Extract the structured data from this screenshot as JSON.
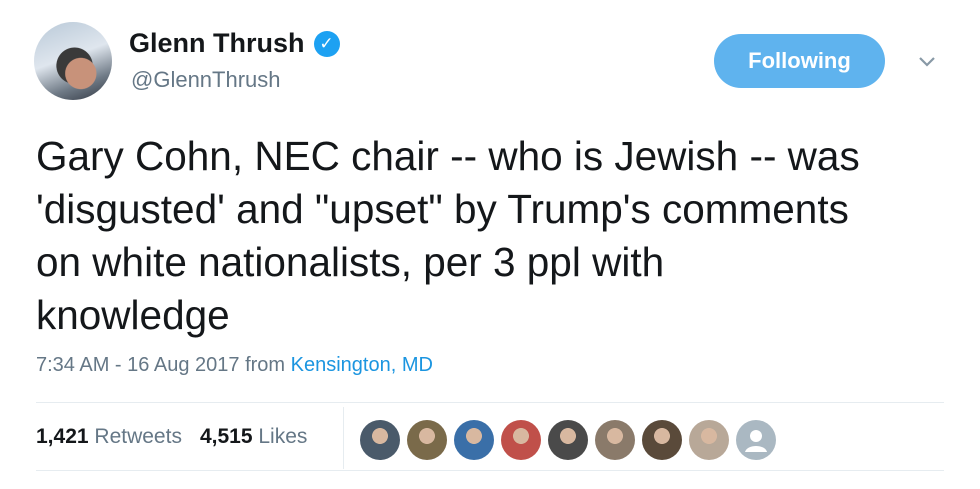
{
  "author": {
    "name": "Glenn Thrush",
    "handle": "@GlennThrush",
    "verified_icon": "verified-check-icon"
  },
  "follow_button": {
    "label": "Following"
  },
  "caret_icon": "chevron-down-icon",
  "tweet": {
    "text": "Gary Cohn, NEC chair -- who is Jewish -- was\n'disgusted' and \"upset\" by Trump's comments\non white nationalists, per 3 ppl with\nknowledge"
  },
  "meta": {
    "time": "7:34 AM - 16 Aug 2017",
    "from_label": "from",
    "location": "Kensington, MD"
  },
  "stats": {
    "retweets_count": "1,421",
    "retweets_label": "Retweets",
    "likes_count": "4,515",
    "likes_label": "Likes"
  },
  "likers": [
    {
      "color": "#4a5a6a"
    },
    {
      "color": "#7a6a4a"
    },
    {
      "color": "#3a6fa8"
    },
    {
      "color": "#c0504a"
    },
    {
      "color": "#4a4a4a"
    },
    {
      "color": "#8a7a6a"
    },
    {
      "color": "#5a4a3a"
    },
    {
      "color": "#b8a898"
    },
    {
      "color": "#aab8c2"
    }
  ],
  "colors": {
    "accent": "#1da1f2",
    "link": "#1b95e0",
    "follow_button": "#5fb3ee",
    "secondary_text": "#657786"
  }
}
